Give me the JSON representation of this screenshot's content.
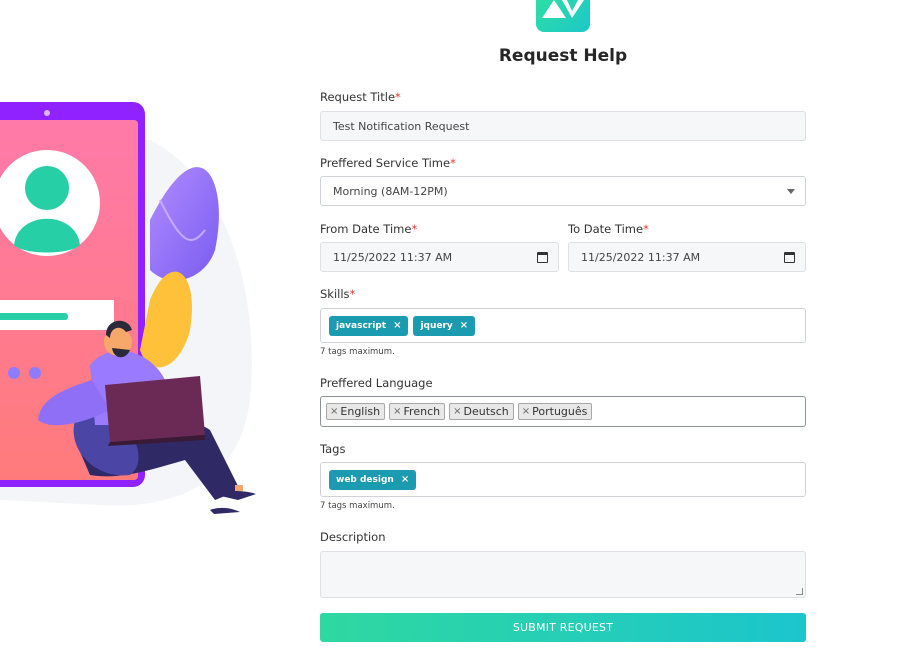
{
  "header": {
    "title": "Request Help"
  },
  "form": {
    "request_title": {
      "label": "Request Title",
      "required_mark": "*",
      "value": "Test Notification Request"
    },
    "service_time": {
      "label": "Preffered Service Time",
      "required_mark": "*",
      "value": "Morning (8AM-12PM)"
    },
    "from_date": {
      "label": "From Date Time",
      "required_mark": "*",
      "value": "11/25/2022 11:37 AM"
    },
    "to_date": {
      "label": "To Date Time",
      "required_mark": "*",
      "value": "11/25/2022 11:37 AM"
    },
    "skills": {
      "label": "Skills",
      "required_mark": "*",
      "tags": [
        "javascript",
        "jquery"
      ],
      "hint": "7 tags maximum."
    },
    "language": {
      "label": "Preffered Language",
      "options": [
        "English",
        "French",
        "Deutsch",
        "Português"
      ]
    },
    "tags": {
      "label": "Tags",
      "tags": [
        "web design"
      ],
      "hint": "7 tags maximum."
    },
    "description": {
      "label": "Description",
      "value": ""
    },
    "remove_glyph": "×",
    "submit_label": "SUBMIT REQUEST"
  },
  "colors": {
    "accent_start": "#2fd8a0",
    "accent_end": "#1cc5cc",
    "chip": "#1a9bb0",
    "required": "#e53935"
  }
}
